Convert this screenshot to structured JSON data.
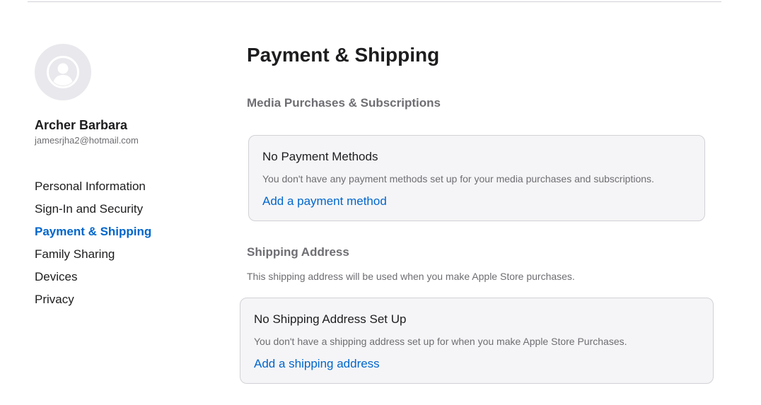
{
  "user": {
    "name": "Archer Barbara",
    "email": "jamesrjha2@hotmail.com"
  },
  "sidebar": {
    "items": [
      {
        "label": "Personal Information",
        "active": false
      },
      {
        "label": "Sign-In and Security",
        "active": false
      },
      {
        "label": "Payment & Shipping",
        "active": true
      },
      {
        "label": "Family Sharing",
        "active": false
      },
      {
        "label": "Devices",
        "active": false
      },
      {
        "label": "Privacy",
        "active": false
      }
    ]
  },
  "main": {
    "title": "Payment & Shipping",
    "media_section": {
      "heading": "Media Purchases & Subscriptions",
      "card": {
        "title": "No Payment Methods",
        "description": "You don't have any payment methods set up for your media purchases and subscriptions.",
        "link": "Add a payment method"
      }
    },
    "shipping_section": {
      "heading": "Shipping Address",
      "description": "This shipping address will be used when you make Apple Store purchases.",
      "card": {
        "title": "No Shipping Address Set Up",
        "description": "You don't have a shipping address set up for when you make Apple Store Purchases.",
        "link": "Add a shipping address"
      }
    }
  },
  "colors": {
    "accent": "#0066cc",
    "text_primary": "#1d1d1f",
    "text_secondary": "#6e6e73",
    "card_bg": "#f5f5f7",
    "avatar_bg": "#e8e8ed"
  },
  "icons": {
    "avatar": "person-circle-icon"
  }
}
